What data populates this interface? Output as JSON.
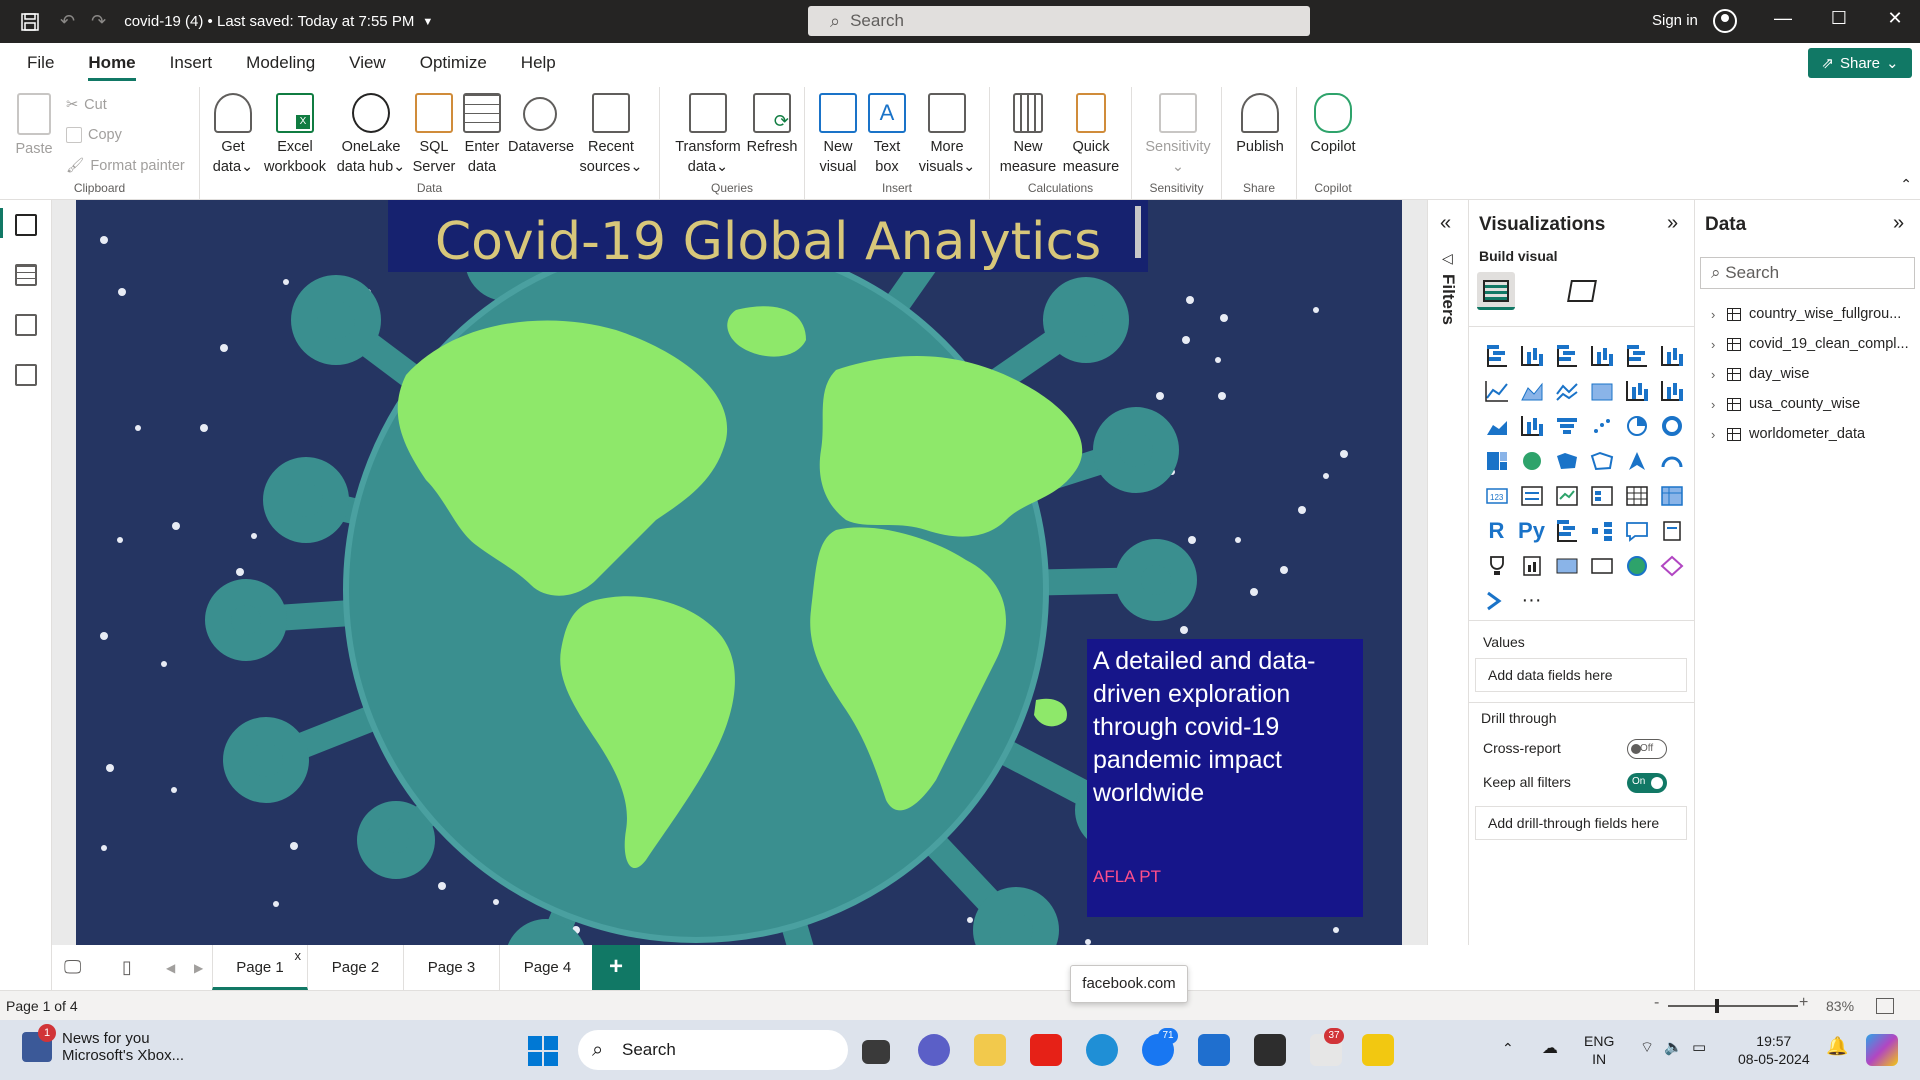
{
  "titlebar": {
    "doc_title": "covid-19 (4)  •  Last saved: Today at 7:55 PM",
    "search_placeholder": "Search",
    "signin": "Sign in",
    "minimize": "—",
    "maximize": "☐",
    "close": "✕"
  },
  "menu": {
    "tabs": [
      "File",
      "Home",
      "Insert",
      "Modeling",
      "View",
      "Optimize",
      "Help"
    ],
    "active": "Home",
    "share": "Share"
  },
  "ribbon": {
    "clipboard": {
      "paste": "Paste",
      "cut": "Cut",
      "copy": "Copy",
      "format_painter": "Format painter",
      "label": "Clipboard"
    },
    "data": {
      "get_data": "Get data",
      "excel": "Excel workbook",
      "onelake": "OneLake data hub",
      "sql": "SQL Server",
      "enter": "Enter data",
      "dataverse": "Dataverse",
      "recent": "Recent sources",
      "label": "Data"
    },
    "queries": {
      "transform": "Transform data",
      "refresh": "Refresh",
      "label": "Queries"
    },
    "insert": {
      "new_visual": "New visual",
      "text_box": "Text box",
      "more_visuals": "More visuals",
      "label": "Insert"
    },
    "calculations": {
      "new_measure": "New measure",
      "quick_measure": "Quick measure",
      "label": "Calculations"
    },
    "sensitivity": {
      "sensitivity": "Sensitivity",
      "label": "Sensitivity"
    },
    "share": {
      "publish": "Publish",
      "label": "Share"
    },
    "copilot": {
      "copilot": "Copilot",
      "label": "Copilot"
    }
  },
  "report": {
    "title": "Covid-19 Global Analytics",
    "description": "A detailed and data-driven exploration through covid-19 pandemic impact worldwide",
    "author": "AFLA PT",
    "colors": {
      "background": "#253562",
      "globe_ocean": "#3a8f8f",
      "continents": "#8ee86a",
      "title_box": "#16226f",
      "title_text": "#d8c77a",
      "desc_box": "#16158a",
      "author": "#ff4f8b"
    }
  },
  "pages": {
    "tabs": [
      "Page 1",
      "Page 2",
      "Page 3",
      "Page 4"
    ],
    "active": "Page 1",
    "close": "x",
    "add": "+"
  },
  "status": {
    "page_info": "Page 1 of 4",
    "tooltip": "facebook.com",
    "zoom": "83%",
    "zoom_minus": "-",
    "zoom_plus": "+"
  },
  "filters": {
    "label": "Filters"
  },
  "visualizations": {
    "title": "Visualizations",
    "build_visual": "Build visual",
    "values": "Values",
    "values_well": "Add data fields here",
    "drill_through": "Drill through",
    "cross_report": "Cross-report",
    "cross_report_state": "Off",
    "keep_filters": "Keep all filters",
    "keep_filters_state": "On",
    "drill_well": "Add drill-through fields here",
    "more": "···"
  },
  "data_pane": {
    "title": "Data",
    "search_placeholder": "Search",
    "tables": [
      "country_wise_fullgrou...",
      "covid_19_clean_compl...",
      "day_wise",
      "usa_county_wise",
      "worldometer_data"
    ]
  },
  "taskbar": {
    "news_title": "News for you",
    "news_sub": "Microsoft's Xbox...",
    "news_badge": "1",
    "search": "Search",
    "badge_71": "71",
    "badge_37": "37",
    "lang": "ENG",
    "region": "IN",
    "time": "19:57",
    "date": "08-05-2024"
  }
}
